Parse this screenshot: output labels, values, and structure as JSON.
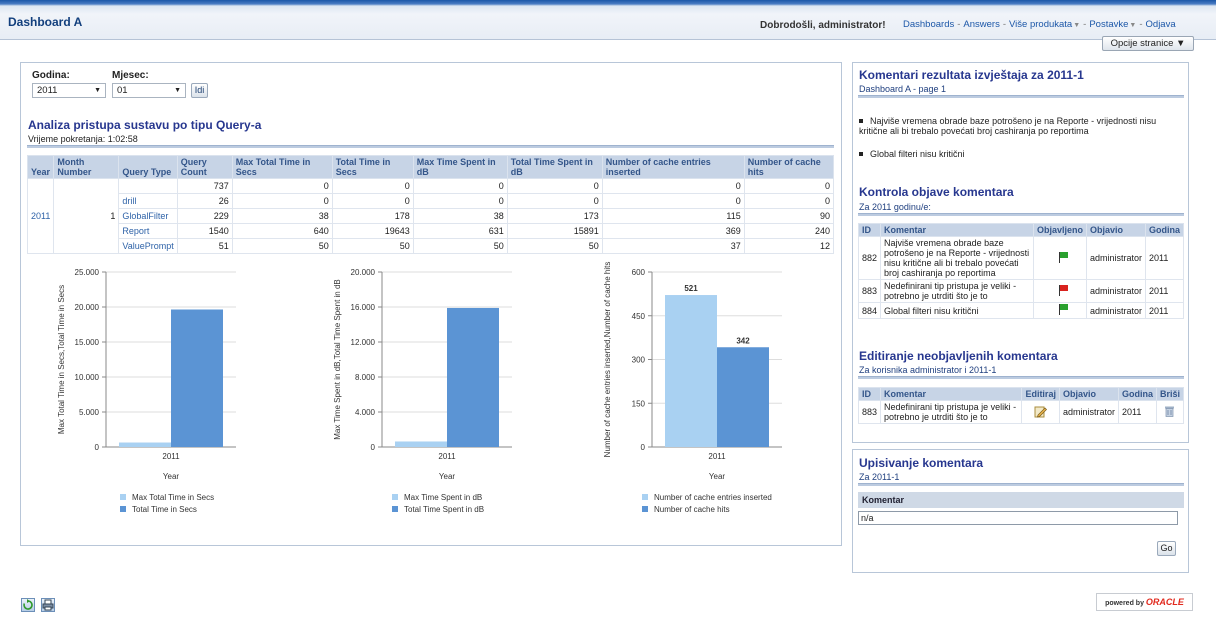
{
  "header": {
    "title": "Dashboard A",
    "welcome": "Dobrodošli, administrator!",
    "nav": [
      {
        "label": "Dashboards",
        "dropdown": false
      },
      {
        "label": "Answers",
        "dropdown": false
      },
      {
        "label": "Više produkata",
        "dropdown": true
      },
      {
        "label": "Postavke",
        "dropdown": true
      },
      {
        "label": "Odjava",
        "dropdown": false
      }
    ],
    "page_options": "Opcije stranice ▼"
  },
  "prompts": {
    "year_label": "Godina:",
    "year_value": "2011",
    "month_label": "Mjesec:",
    "month_value": "01",
    "go_label": "Idi"
  },
  "report": {
    "title": "Analiza pristupa sustavu po tipu Query-a",
    "runtime": "Vrijeme pokretanja: 1:02:58",
    "columns": [
      "Year",
      "Month Number",
      "Query Type",
      "Query Count",
      "Max Total Time in Secs",
      "Total Time in Secs",
      "Max Time Spent in dB",
      "Total Time Spent in dB",
      "Number of cache entries inserted",
      "Number of cache hits"
    ],
    "year": "2011",
    "month": "1",
    "rows": [
      {
        "type": "",
        "count": "737",
        "max_total_time": "0",
        "total_time": "0",
        "max_db": "0",
        "total_db": "0",
        "cache_inserted": "0",
        "cache_hits": "0"
      },
      {
        "type": "drill",
        "count": "26",
        "max_total_time": "0",
        "total_time": "0",
        "max_db": "0",
        "total_db": "0",
        "cache_inserted": "0",
        "cache_hits": "0"
      },
      {
        "type": "GlobalFilter",
        "count": "229",
        "max_total_time": "38",
        "total_time": "178",
        "max_db": "38",
        "total_db": "173",
        "cache_inserted": "115",
        "cache_hits": "90"
      },
      {
        "type": "Report",
        "count": "1540",
        "max_total_time": "640",
        "total_time": "19643",
        "max_db": "631",
        "total_db": "15891",
        "cache_inserted": "369",
        "cache_hits": "240"
      },
      {
        "type": "ValuePrompt",
        "count": "51",
        "max_total_time": "50",
        "total_time": "50",
        "max_db": "50",
        "total_db": "50",
        "cache_inserted": "37",
        "cache_hits": "12"
      }
    ]
  },
  "chart_data": [
    {
      "type": "bar",
      "categories": [
        "2011"
      ],
      "series": [
        {
          "name": "Max Total Time in Secs",
          "values": [
            640
          ]
        },
        {
          "name": "Total Time in Secs",
          "values": [
            19643
          ]
        }
      ],
      "xlabel": "Year",
      "ylabel": "Max Total Time in Secs,Total Time in Secs",
      "ylim": [
        0,
        25000
      ],
      "yticks": [
        "0",
        "5.000",
        "10.000",
        "15.000",
        "20.000",
        "25.000"
      ],
      "data_labels": [],
      "colors": [
        "#a9d1f2",
        "#5b94d4"
      ],
      "legend": "bottom"
    },
    {
      "type": "bar",
      "categories": [
        "2011"
      ],
      "series": [
        {
          "name": "Max Time Spent in dB",
          "values": [
            631
          ]
        },
        {
          "name": "Total Time Spent in dB",
          "values": [
            15891
          ]
        }
      ],
      "xlabel": "Year",
      "ylabel": "Max Time Spent in dB,Total Time Spent in dB",
      "ylim": [
        0,
        20000
      ],
      "yticks": [
        "0",
        "4.000",
        "8.000",
        "12.000",
        "16.000",
        "20.000"
      ],
      "data_labels": [],
      "colors": [
        "#a9d1f2",
        "#5b94d4"
      ],
      "legend": "bottom"
    },
    {
      "type": "bar",
      "categories": [
        "2011"
      ],
      "series": [
        {
          "name": "Number of cache entries inserted",
          "values": [
            521
          ]
        },
        {
          "name": "Number of cache hits",
          "values": [
            342
          ]
        }
      ],
      "xlabel": "Year",
      "ylabel": "Number of cache entries inserted,Number of cache hits",
      "ylim": [
        0,
        600
      ],
      "yticks": [
        "0",
        "150",
        "300",
        "450",
        "600"
      ],
      "data_labels": [
        "521",
        "342"
      ],
      "colors": [
        "#a9d1f2",
        "#5b94d4"
      ],
      "legend": "bottom"
    }
  ],
  "comments_report": {
    "title": "Komentari rezultata izvještaja za 2011-1",
    "subtitle": "Dashboard A - page 1",
    "bullets": [
      "Najviše vremena obrade baze potrošeno je na Reporte - vrijednosti nisu kritične ali bi trebalo povećati broj cashiranja po reportima",
      "Global filteri nisu kritični"
    ]
  },
  "publish_control": {
    "title": "Kontrola objave komentara",
    "subtitle": "Za 2011 godinu/e:",
    "columns": [
      "ID",
      "Komentar",
      "Objavljeno",
      "Objavio",
      "Godina"
    ],
    "rows": [
      {
        "id": "882",
        "comment": "Najviše vremena obrade baze potrošeno je na Reporte - vrijednosti nisu kritične ali bi trebalo povećati broj cashiranja po reportima",
        "flag": "green",
        "by": "administrator",
        "year": "2011"
      },
      {
        "id": "883",
        "comment": "Nedefinirani tip pristupa je veliki - potrebno je utrditi što je to",
        "flag": "red",
        "by": "administrator",
        "year": "2011"
      },
      {
        "id": "884",
        "comment": "Global filteri nisu kritični",
        "flag": "green",
        "by": "administrator",
        "year": "2011"
      }
    ]
  },
  "edit_unpublished": {
    "title": "Editiranje neobjavljenih komentara",
    "subtitle": "Za korisnika administrator i 2011-1",
    "columns": [
      "ID",
      "Komentar",
      "Editiraj",
      "Objavio",
      "Godina",
      "Briši"
    ],
    "rows": [
      {
        "id": "883",
        "comment": "Nedefinirani tip pristupa je veliki - potrebno je utrditi što je to",
        "by": "administrator",
        "year": "2011"
      }
    ]
  },
  "write_comment": {
    "title": "Upisivanje komentara",
    "subtitle": "Za 2011-1",
    "field_label": "Komentar",
    "field_value": "n/a",
    "go_label": "Go"
  },
  "footer": {
    "powered_by": "powered by",
    "brand": "ORACLE"
  }
}
